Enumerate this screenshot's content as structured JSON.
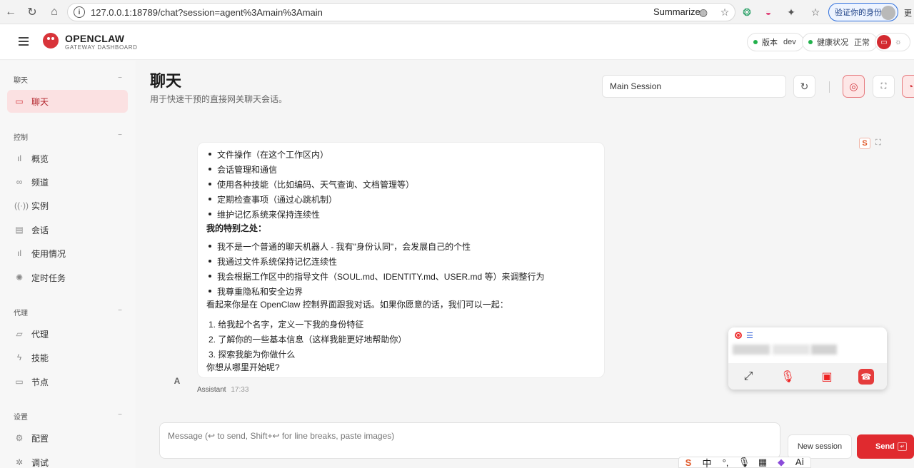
{
  "browser": {
    "url": "127.0.0.1:18789/chat?session=agent%3Amain%3Amain",
    "summarize": "Summarize",
    "verify_label": "验证你的身份",
    "more_label": "更"
  },
  "header": {
    "brand": "OPENCLAW",
    "brand_sub": "GATEWAY DASHBOARD",
    "version_label": "版本",
    "version_value": "dev",
    "health_label": "健康状况",
    "health_value": "正常"
  },
  "sidebar": {
    "sections": [
      {
        "title": "聊天",
        "items": [
          {
            "label": "聊天",
            "icon": "chat-icon",
            "active": true
          }
        ]
      },
      {
        "title": "控制",
        "items": [
          {
            "label": "概览",
            "icon": "bar-chart-icon"
          },
          {
            "label": "频道",
            "icon": "link-icon"
          },
          {
            "label": "实例",
            "icon": "broadcast-icon"
          },
          {
            "label": "会话",
            "icon": "document-icon"
          },
          {
            "label": "使用情况",
            "icon": "bar-chart-icon"
          },
          {
            "label": "定时任务",
            "icon": "spinner-icon"
          }
        ]
      },
      {
        "title": "代理",
        "items": [
          {
            "label": "代理",
            "icon": "folder-icon"
          },
          {
            "label": "技能",
            "icon": "lightning-icon"
          },
          {
            "label": "节点",
            "icon": "monitor-icon"
          }
        ]
      },
      {
        "title": "设置",
        "items": [
          {
            "label": "配置",
            "icon": "gear-icon"
          },
          {
            "label": "调试",
            "icon": "bug-icon"
          }
        ]
      }
    ]
  },
  "main": {
    "title": "聊天",
    "subtitle": "用于快速干预的直接网关聊天会话。",
    "session_select": "Main Session"
  },
  "message": {
    "list1": [
      "文件操作（在这个工作区内）",
      "会话管理和通信",
      "使用各种技能（比如编码、天气查询、文档管理等）",
      "定期检查事项（通过心跳机制）",
      "维护记忆系统来保持连续性"
    ],
    "heading": "我的特别之处：",
    "list2": [
      "我不是一个普通的聊天机器人 - 我有\"身份认同\"，会发展自己的个性",
      "我通过文件系统保持记忆连续性",
      "我会根据工作区中的指导文件（SOUL.md、IDENTITY.md、USER.md 等）来调整行为",
      "我尊重隐私和安全边界"
    ],
    "para": "看起来你是在 OpenClaw 控制界面跟我对话。如果你愿意的话，我们可以一起：",
    "ordered": [
      "1. 给我起个名字，定义一下我的身份特征",
      "2. 了解你的一些基本信息（这样我能更好地帮助你）",
      "3. 探索我能为你做什么"
    ],
    "closing": "你想从哪里开始呢?",
    "avatar": "A",
    "sender": "Assistant",
    "time": "17:33"
  },
  "composer": {
    "placeholder": "Message (↩ to send, Shift+↩ for line breaks, paste images)",
    "new_session": "New session",
    "send": "Send"
  },
  "ime": [
    "S",
    "中",
    "°,",
    "🎙",
    "▦",
    "◆",
    "Aⅰ"
  ]
}
